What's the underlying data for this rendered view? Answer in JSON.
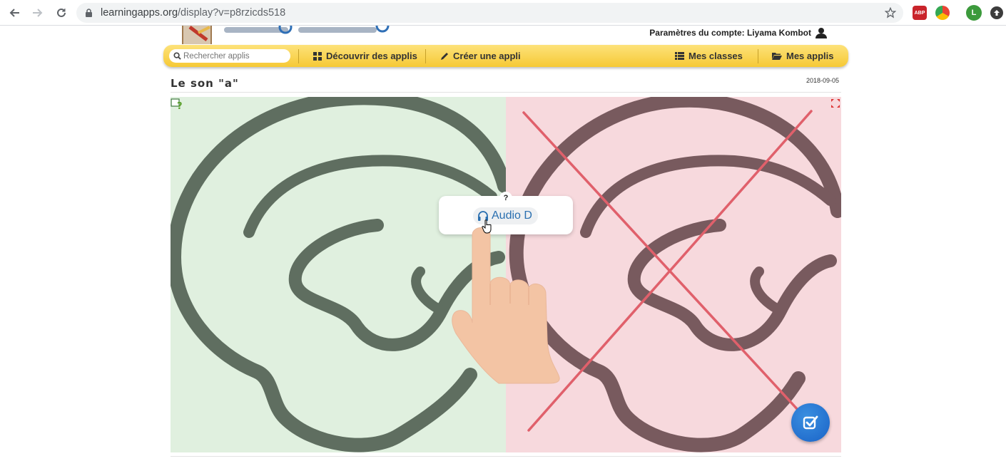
{
  "browser": {
    "url_host": "learningapps.org",
    "url_path": "/display?v=p8rzicds518",
    "profile_letter": "L",
    "adblock_label": "ABP"
  },
  "header": {
    "account_label": "Paramètres du compte: Liyama Kombot"
  },
  "menu": {
    "search_placeholder": "Rechercher applis",
    "discover_label": "Découvrir des applis",
    "create_label": "Créer une appli",
    "classes_label": "Mes classes",
    "apps_label": "Mes applis"
  },
  "app": {
    "title": "Le son \"a\"",
    "date": "2018-09-05",
    "card_question_mark": "?",
    "audio_label": "Audio D"
  },
  "colors": {
    "left_bg": "#e0f0df",
    "right_bg": "#f7d9dd",
    "left_ear": "#5f6e60",
    "right_ear": "#785a5e",
    "cross": "#e0606b",
    "menubar": "#f6c935",
    "check_button": "#1a63c7"
  }
}
